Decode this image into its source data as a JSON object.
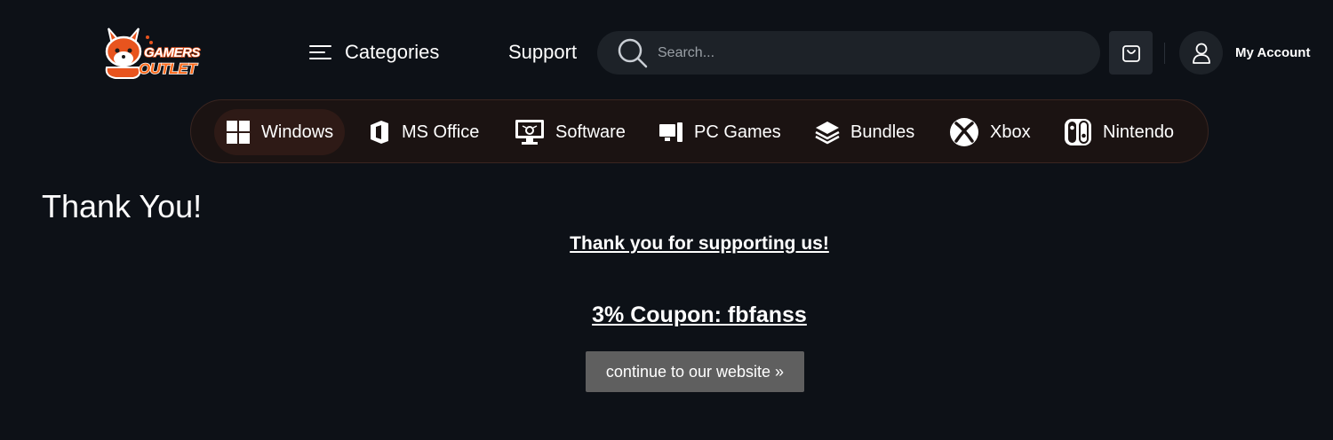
{
  "header": {
    "logo_line1": "GAMERS",
    "logo_line2": "OUTLET",
    "categories_label": "Categories",
    "support_label": "Support",
    "search_placeholder": "Search...",
    "account_label": "My Account"
  },
  "category_bar": {
    "items": [
      {
        "label": "Windows",
        "icon": "windows-icon",
        "active": true
      },
      {
        "label": "MS Office",
        "icon": "office-icon"
      },
      {
        "label": "Software",
        "icon": "software-icon"
      },
      {
        "label": "PC Games",
        "icon": "pc-games-icon"
      },
      {
        "label": "Bundles",
        "icon": "bundles-icon"
      },
      {
        "label": "Xbox",
        "icon": "xbox-icon"
      },
      {
        "label": "Nintendo",
        "icon": "nintendo-icon"
      }
    ]
  },
  "main": {
    "title": "Thank You!",
    "message": "Thank you for supporting us!",
    "coupon": "3% Coupon: fbfanss",
    "continue_label": "continue to our website »"
  },
  "colors": {
    "background": "#0d1117",
    "category_bar_bg": "#1b1312",
    "brand_orange": "#e8541e",
    "button_gray": "#5f5f5f"
  }
}
